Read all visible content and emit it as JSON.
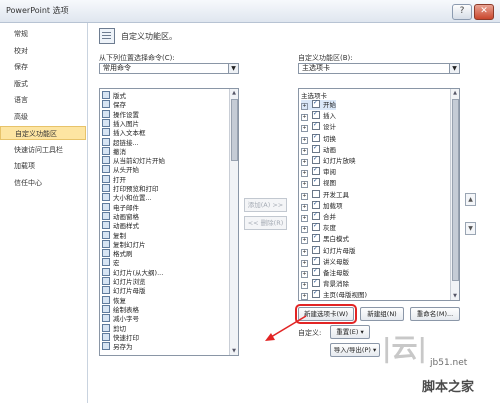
{
  "window": {
    "title": "PowerPoint 选项",
    "help": "?",
    "close": "✕"
  },
  "sidebar": {
    "items": [
      {
        "label": "常规"
      },
      {
        "label": "校对"
      },
      {
        "label": "保存"
      },
      {
        "label": "版式"
      },
      {
        "label": "语言"
      },
      {
        "label": "高级"
      },
      {
        "label": "自定义功能区"
      },
      {
        "label": "快速访问工具栏"
      },
      {
        "label": "加载项"
      },
      {
        "label": "信任中心"
      }
    ],
    "active_index": 6
  },
  "header": {
    "title": "自定义功能区。"
  },
  "left": {
    "label": "从下列位置选择命令(C):",
    "dropdown_value": "常用命令",
    "commands": [
      "版式",
      "保存",
      "操作设置",
      "插入图片",
      "插入文本框",
      "超链接...",
      "撤消",
      "从当前幻灯片开始",
      "从头开始",
      "打开",
      "打印预览和打印",
      "大小和位置...",
      "电子邮件",
      "动画窗格",
      "动画样式",
      "复制",
      "复制幻灯片",
      "格式刷",
      "宏",
      "幻灯片(从大纲)...",
      "幻灯片浏览",
      "幻灯片母版",
      "恢复",
      "绘制表格",
      "减小字号",
      "剪切",
      "快速打印",
      "另存为"
    ]
  },
  "middle": {
    "add_label": "添加(A) >>",
    "remove_label": "<< 删除(R)"
  },
  "right": {
    "label": "自定义功能区(B):",
    "dropdown_value": "主选项卡",
    "tree_header": "主选项卡",
    "tabs": [
      {
        "label": "开始",
        "checked": true
      },
      {
        "label": "插入",
        "checked": true
      },
      {
        "label": "设计",
        "checked": true
      },
      {
        "label": "切换",
        "checked": true
      },
      {
        "label": "动画",
        "checked": true
      },
      {
        "label": "幻灯片放映",
        "checked": true
      },
      {
        "label": "审阅",
        "checked": true
      },
      {
        "label": "视图",
        "checked": true
      },
      {
        "label": "开发工具",
        "checked": false
      },
      {
        "label": "加载项",
        "checked": true
      },
      {
        "label": "合并",
        "checked": true
      },
      {
        "label": "灰度",
        "checked": true
      },
      {
        "label": "黑白模式",
        "checked": true
      },
      {
        "label": "幻灯片母版",
        "checked": true
      },
      {
        "label": "讲义母版",
        "checked": true
      },
      {
        "label": "备注母版",
        "checked": true
      },
      {
        "label": "背景消除",
        "checked": true
      },
      {
        "label": "主页(母版视图)",
        "checked": true
      }
    ],
    "new_tab_label": "新建选项卡(W)",
    "new_group_label": "新建组(N)",
    "rename_label": "重命名(M)...",
    "customize_label": "自定义:",
    "reset_label": "重置(E) ▾",
    "import_export_label": "导入/导出(P) ▾"
  },
  "watermark": {
    "mark": "|云|",
    "url": "jb51.net",
    "name": "脚本之家"
  }
}
